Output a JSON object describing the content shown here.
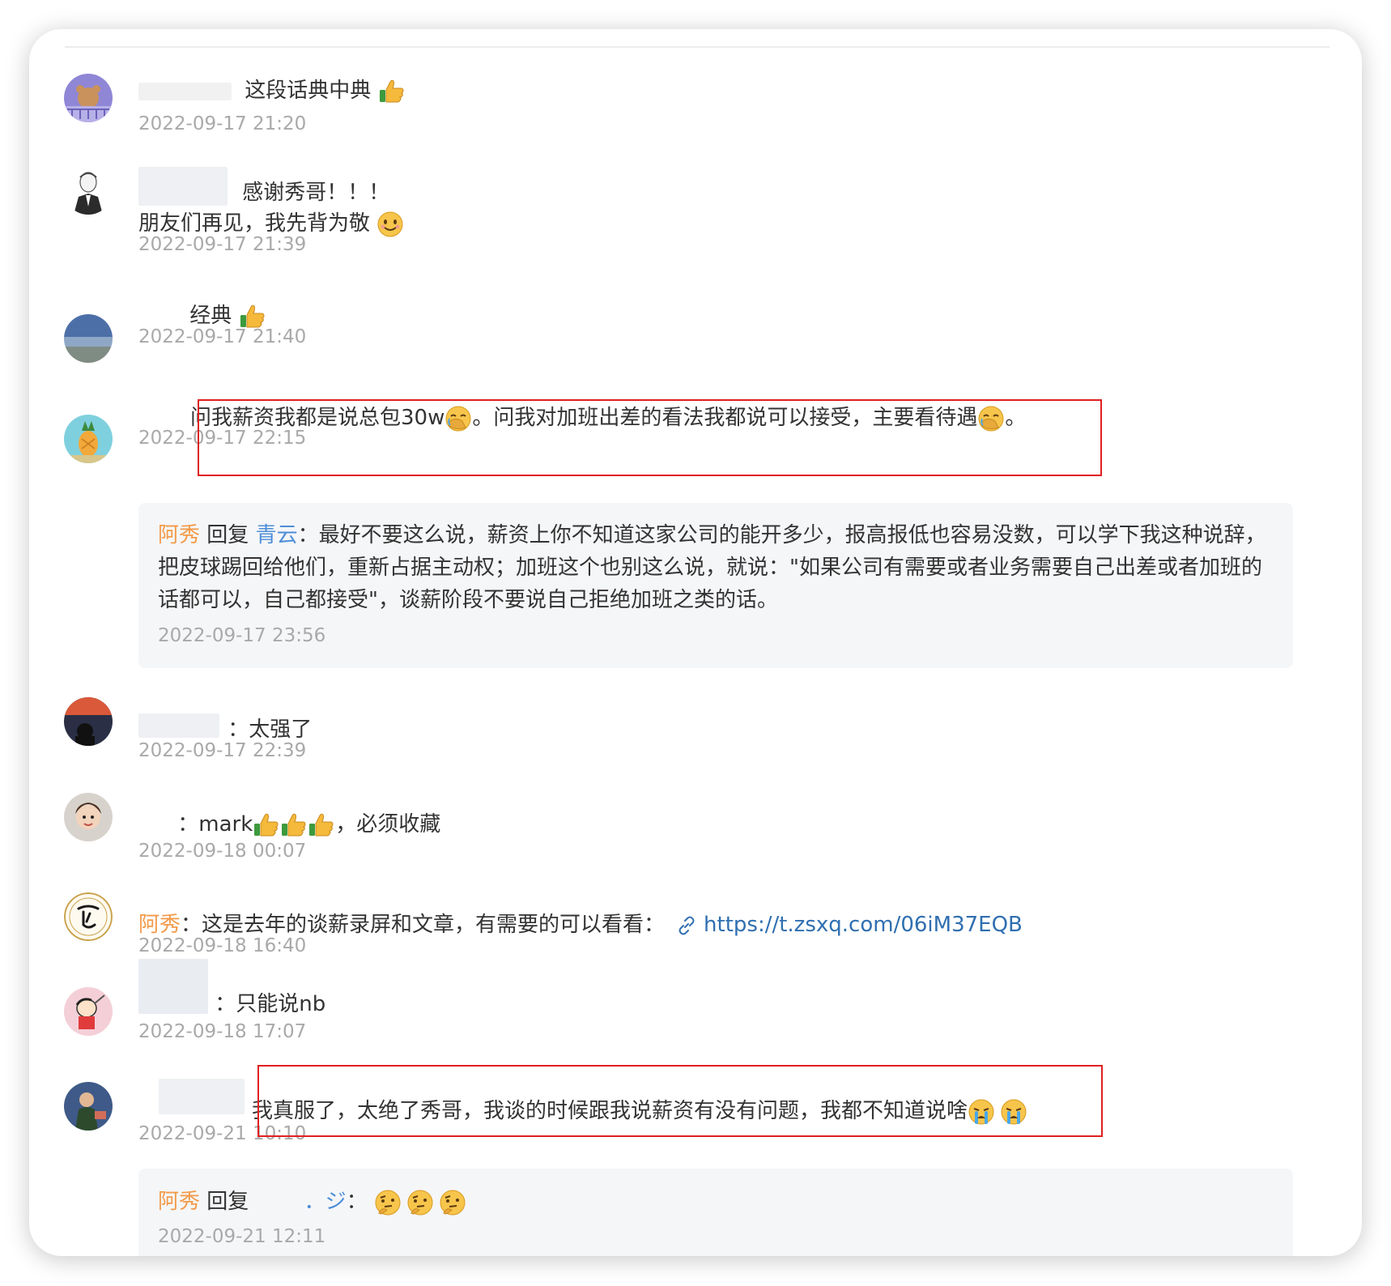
{
  "comments": [
    {
      "text": "这段话典中典",
      "timestamp": "2022-09-17 21:20",
      "avatar_icon": "bear-cartoon-avatar",
      "emojis": [
        "thumbs-up"
      ]
    },
    {
      "text": "感谢秀哥！！！",
      "text_line2": "朋友们再见，我先背为敬",
      "timestamp": "2022-09-17 21:39",
      "avatar_icon": "sketch-man-avatar",
      "emojis": [
        "smiling-face"
      ]
    },
    {
      "text": "经典",
      "timestamp": "2022-09-17 21:40",
      "avatar_icon": "sea-landscape-avatar",
      "emojis": [
        "thumbs-up"
      ]
    },
    {
      "text_part1": "问我薪资我都是说总包30w",
      "text_part2": "。问我对加班出差的看法我都说可以接受，主要看待遇",
      "text_part3": "。",
      "timestamp": "2022-09-17 22:15",
      "avatar_icon": "pineapple-house-avatar",
      "emojis": [
        "facepalm",
        "facepalm"
      ],
      "reply": {
        "author": "阿秀",
        "verb": "回复",
        "target": "青云",
        "text": "：最好不要这么说，薪资上你不知道这家公司的能开多少，报高报低也容易没数，可以学下我这种说辞，把皮球踢回给他们，重新占据主动权；加班这个也别这么说，就说：\"如果公司有需要或者业务需要自己出差或者加班的话都可以，自己都接受\"，谈薪阶段不要说自己拒绝加班之类的话。",
        "timestamp": "2022-09-17 23:56"
      }
    },
    {
      "text": "：太强了",
      "timestamp": "2022-09-17 22:39",
      "avatar_icon": "sunset-silhouette-avatar"
    },
    {
      "text_part1": "：mark",
      "text_part2": "，必须收藏",
      "timestamp": "2022-09-18 00:07",
      "avatar_icon": "child-photo-avatar",
      "emojis": [
        "thumbs-up",
        "thumbs-up",
        "thumbs-up"
      ]
    },
    {
      "author": "阿秀",
      "text": "：这是去年的谈薪录屏和文章，有需要的可以看看：",
      "link": "https://t.zsxq.com/06iM37EQB",
      "timestamp": "2022-09-18 16:40",
      "avatar_icon": "calligraphy-logo-avatar"
    },
    {
      "text": "：只能说nb",
      "timestamp": "2022-09-18 17:07",
      "avatar_icon": "cartoon-boy-avatar"
    },
    {
      "text": "我真服了，太绝了秀哥，我谈的时候跟我说薪资有没有问题，我都不知道说啥",
      "timestamp": "2022-09-21 10:10",
      "avatar_icon": "person-photo-avatar",
      "emojis": [
        "crying-face",
        "crying-face"
      ],
      "reply": {
        "author": "阿秀",
        "verb": "回复",
        "target_fragment": "．ジ",
        "colon": "：",
        "timestamp": "2022-09-21 12:11",
        "emojis": [
          "thinking-face",
          "thinking-face",
          "thinking-face"
        ]
      }
    }
  ],
  "colors": {
    "author": "#f39a48",
    "reply_target": "#4d8ed8",
    "link": "#2f6fb0",
    "timestamp": "#a9a9a9",
    "highlight": "#e02020",
    "reply_bg": "#f5f6f8"
  }
}
